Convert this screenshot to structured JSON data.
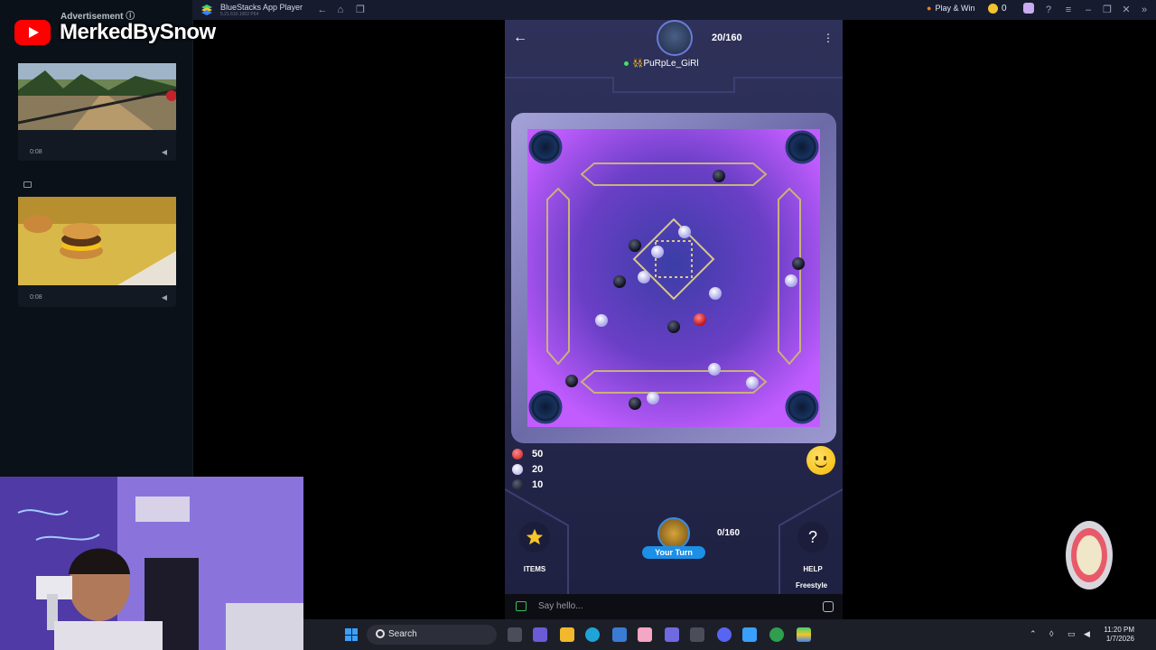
{
  "ads": {
    "label": "Advertisement ⓘ",
    "cards": [
      {
        "duration": "0:08"
      },
      {
        "duration": "0:08"
      }
    ]
  },
  "channel": {
    "name": "MerkedBySnow"
  },
  "titlebar": {
    "app_name": "BlueStacks App Player",
    "app_version": "5.21.610.1002 P64",
    "play_win": "Play & Win",
    "coins": "0"
  },
  "game": {
    "shot_counter": "20/160",
    "opponent_name": "👯‍♀️PuRpLe_GiRl",
    "scores": [
      {
        "kind": "red",
        "value": "50",
        "color": "#e23a3a"
      },
      {
        "kind": "white",
        "value": "20",
        "color": "#c9c6f2"
      },
      {
        "kind": "black",
        "value": "10",
        "color": "#1c1f33"
      }
    ],
    "items_label": "ITEMS",
    "help_label": "HELP",
    "help_glyph": "?",
    "your_turn": "Your Turn",
    "player_counter": "0/160",
    "mode": "Freestyle",
    "chat_placeholder": "Say hello...",
    "board_accent": "#b14cff"
  },
  "taskbar": {
    "search_label": "Search",
    "time": "11:20 PM",
    "date": "1/7/2026"
  }
}
